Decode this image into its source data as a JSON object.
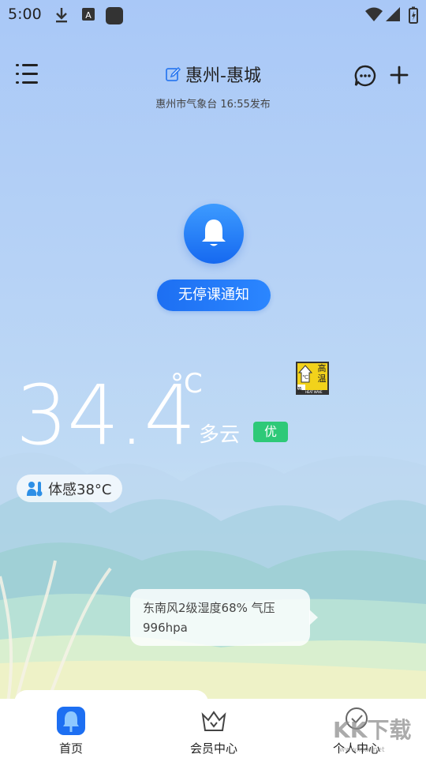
{
  "status_bar": {
    "time": "5:00"
  },
  "header": {
    "location": "惠州-惠城",
    "publish_info": "惠州市气象台 16:55发布"
  },
  "notice": {
    "label": "无停课通知"
  },
  "weather": {
    "temperature": "34.4",
    "unit": "°C",
    "condition": "多云",
    "aqi_level": "优",
    "feels_like": "体感38°C",
    "detail": "东南风2级湿度68% 气压996hpa",
    "alert": {
      "line1": "高",
      "line2": "温",
      "level": "黄",
      "sub": "HEAT WAVE"
    }
  },
  "colors": {
    "accent": "#1d6ff2",
    "aqi_good": "#2ec978",
    "alert_yellow": "#f2d21b"
  },
  "tabs": [
    {
      "label": "首页",
      "icon": "home-icon"
    },
    {
      "label": "会员中心",
      "icon": "crown-icon"
    },
    {
      "label": "个人中心",
      "icon": "person-icon"
    }
  ],
  "watermark": {
    "text": "KK下载",
    "url": "www.kkx.net"
  }
}
